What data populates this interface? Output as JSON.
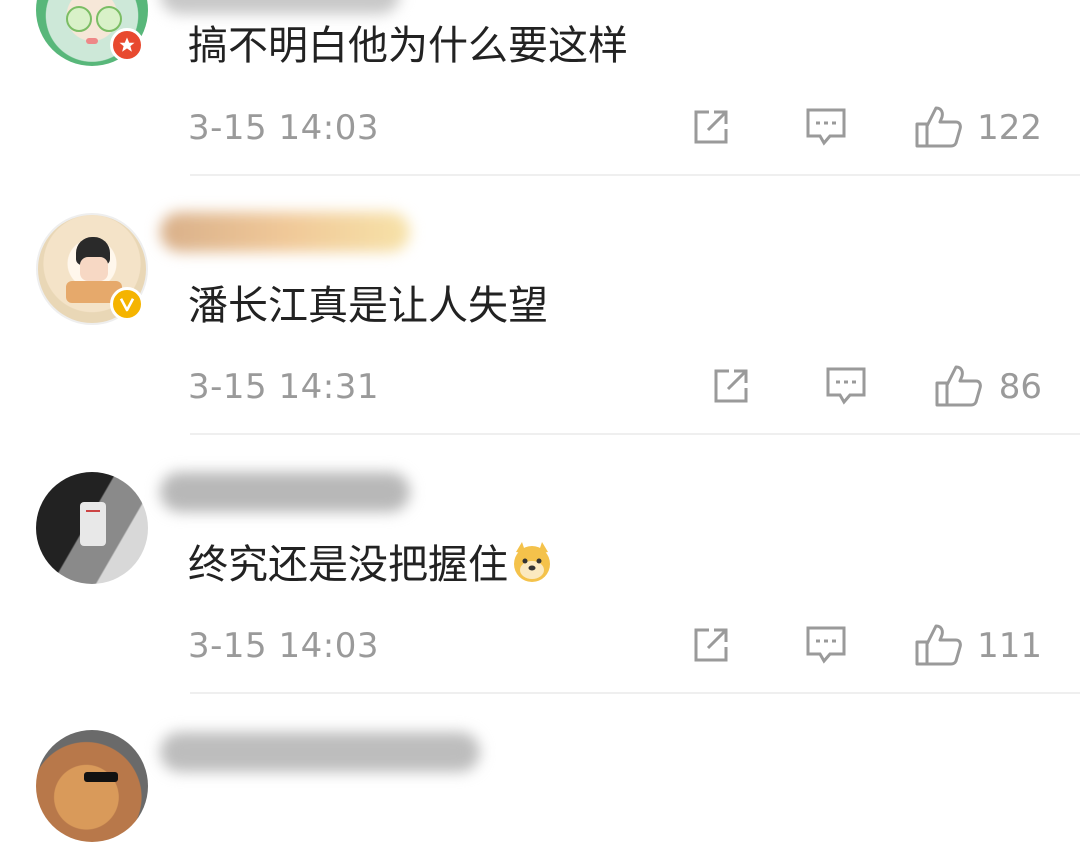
{
  "comments": [
    {
      "text": "搞不明白他为什么要这样",
      "time": "3-15 14:03",
      "likes": "122",
      "avatar_badge": "red-star-badge"
    },
    {
      "text": "潘长江真是让人失望",
      "time": "3-15 14:31",
      "likes": "86",
      "avatar_badge": "verified-v-badge"
    },
    {
      "text": "终究还是没把握住",
      "time": "3-15 14:03",
      "likes": "111",
      "emoji": "doge-emoji"
    }
  ],
  "icons": {
    "share": "share-icon",
    "comment": "comment-icon",
    "like": "thumbs-up-icon"
  },
  "colors": {
    "text": "#222222",
    "meta": "#9a9a9a",
    "divider": "#efefef",
    "badge_red": "#e8492f",
    "badge_gold": "#f5b400"
  }
}
